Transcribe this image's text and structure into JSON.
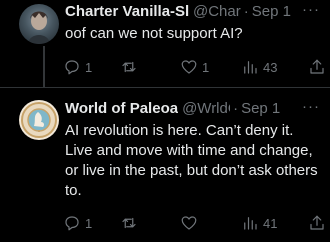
{
  "tweets": [
    {
      "name": "Charter Vanilla-Sl",
      "handle": "@Char",
      "dot": "·",
      "date": "Sep 1",
      "text": "oof can we not support AI?",
      "more": "···",
      "reply_count": "1",
      "retweet_count": "",
      "like_count": "1",
      "view_count": "43"
    },
    {
      "name": "World of Paleoa",
      "handle": "@WrldO",
      "dot": "·",
      "date": "Sep 1",
      "text": "AI revolution is here. Can’t deny it. Live and move with time and change, or live in the past, but don’t ask others to.",
      "more": "···",
      "reply_count": "1",
      "retweet_count": "",
      "like_count": "",
      "view_count": "41"
    }
  ],
  "icons": [
    "reply-icon",
    "retweet-icon",
    "like-icon",
    "views-icon",
    "share-icon",
    "more-icon"
  ],
  "colors": {
    "background": "#000000",
    "text": "#e7e9ea",
    "muted": "#71767b",
    "divider": "#2f3336"
  }
}
